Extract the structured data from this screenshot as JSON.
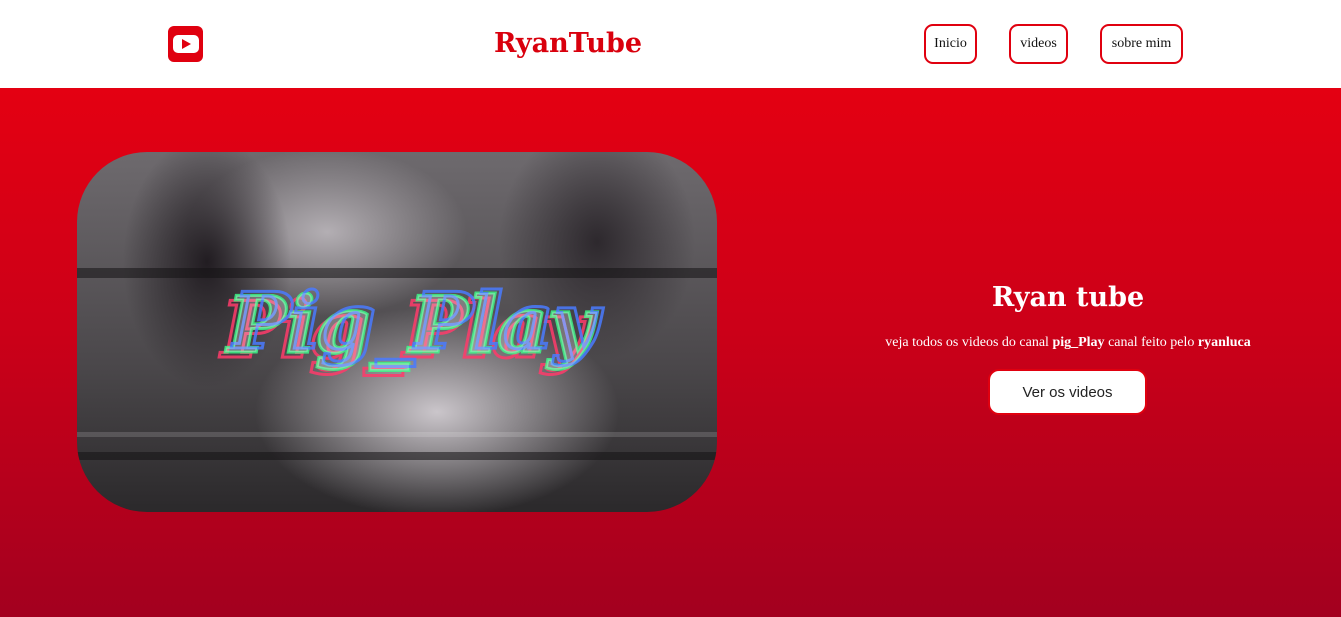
{
  "header": {
    "logo_icon": "youtube-play-icon",
    "brand": "RyanTube",
    "nav": {
      "inicio": "Inicio",
      "videos": "videos",
      "sobre": "sobre mim"
    }
  },
  "hero": {
    "video_title_art": "Pig_Play",
    "title": "Ryan tube",
    "desc_prefix": "veja todos os videos do canal ",
    "desc_channel": "pig_Play",
    "desc_middle": " canal feito pelo ",
    "desc_author": "ryanluca",
    "cta_label": "Ver os videos"
  },
  "colors": {
    "accent": "#e0000f",
    "brand_text": "#d9000d",
    "hero_top": "#e40012",
    "hero_bottom": "#a3001f"
  }
}
